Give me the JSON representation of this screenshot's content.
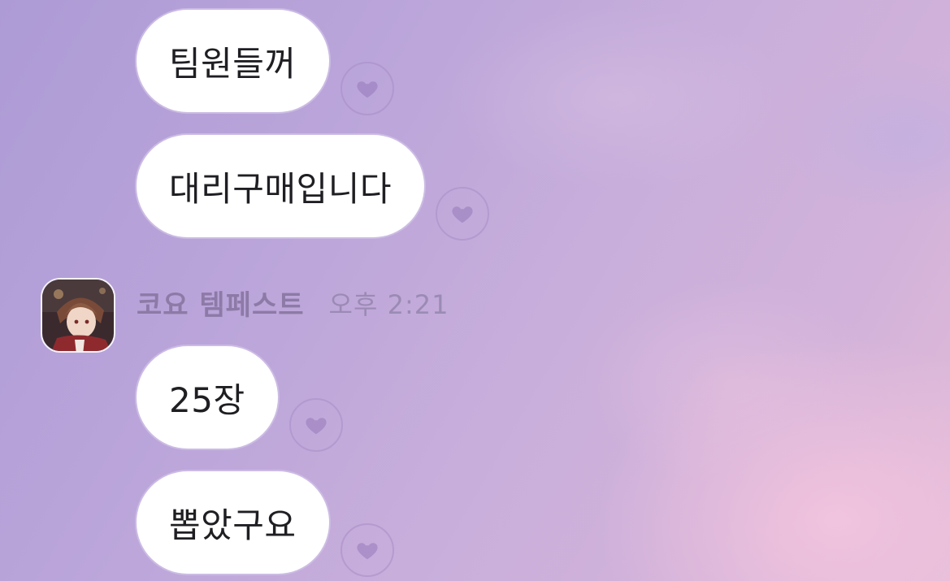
{
  "messages_before": [
    {
      "text": "팀원들꺼"
    },
    {
      "text": "대리구매입니다"
    }
  ],
  "sender": {
    "name": "코요 템페스트",
    "time": "오후 2:21"
  },
  "messages_after": [
    {
      "text": "25장"
    },
    {
      "text": "뽑았구요"
    }
  ],
  "icons": {
    "reaction": "heart-icon",
    "avatar": "anime-character-avatar"
  },
  "colors": {
    "bubble": "#ffffff",
    "text": "#1f1f23",
    "sender_name": "#8d7aa6",
    "timestamp": "#9b8bb4"
  }
}
